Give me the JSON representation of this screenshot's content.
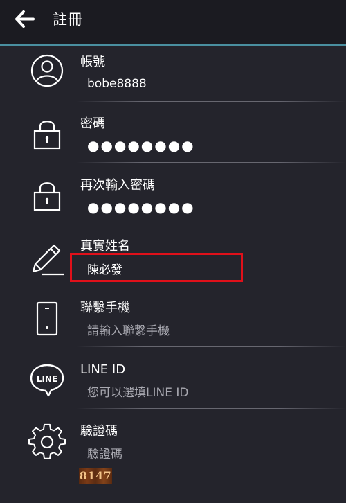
{
  "header": {
    "title": "註冊",
    "back_icon": "arrow-left-icon"
  },
  "colors": {
    "background": "#24242c",
    "header_bg": "#1b1b21",
    "header_border": "#4a8fa0",
    "highlight": "#e0101a"
  },
  "fields": {
    "account": {
      "label": "帳號",
      "value": "bobe8888",
      "icon": "user-circle-icon"
    },
    "password": {
      "label": "密碼",
      "value": "●●●●●●●●",
      "icon": "lock-icon"
    },
    "password_confirm": {
      "label": "再次輸入密碼",
      "value": "●●●●●●●●",
      "icon": "lock-icon"
    },
    "real_name": {
      "label": "真實姓名",
      "value": "陳必發",
      "icon": "pencil-icon"
    },
    "phone": {
      "label": "聯繫手機",
      "placeholder": "請輸入聯繫手機",
      "icon": "mobile-phone-icon"
    },
    "line_id": {
      "label": "LINE ID",
      "placeholder": "您可以選填LINE ID",
      "icon": "line-icon",
      "icon_text": "LINE"
    },
    "captcha": {
      "label": "驗證碼",
      "placeholder": "驗證碼",
      "icon": "gear-icon",
      "image_text": "8147"
    }
  }
}
